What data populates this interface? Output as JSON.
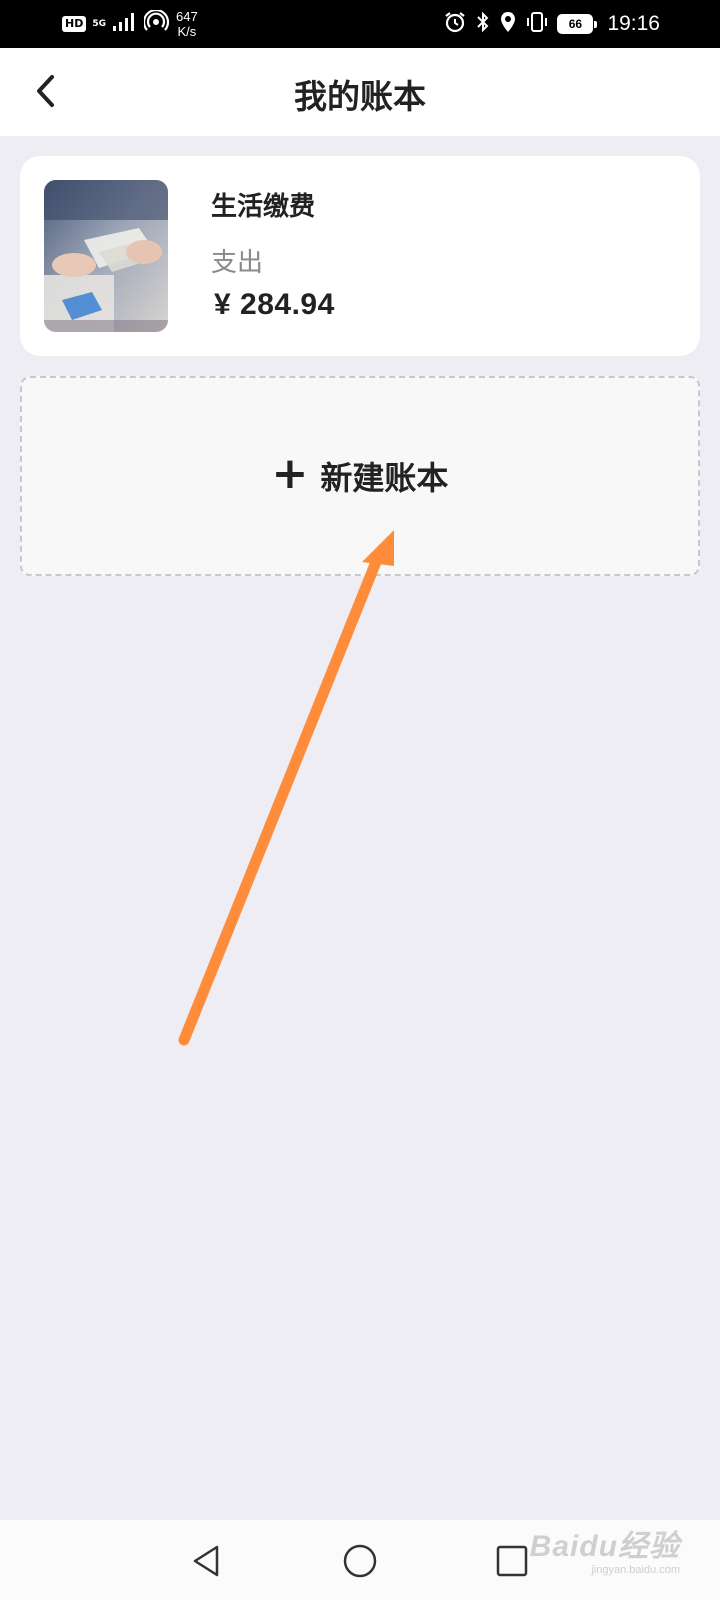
{
  "status_bar": {
    "hd": "HD",
    "network": "5G",
    "net_speed_value": "647",
    "net_speed_unit": "K/s",
    "battery": "66",
    "time": "19:16"
  },
  "header": {
    "title": "我的账本"
  },
  "ledgers": [
    {
      "name": "生活缴费",
      "type": "支出",
      "amount": "¥ 284.94"
    }
  ],
  "new_ledger": {
    "plus": "+",
    "label": "新建账本"
  },
  "watermark": {
    "logo": "Baidu经验",
    "url": "jingyan.baidu.com"
  },
  "colors": {
    "page_bg": "#eeedf3",
    "card_bg": "#ffffff",
    "annotation_arrow": "#ff8c3a",
    "text_primary": "#222222",
    "text_secondary": "#8a8a8a"
  }
}
